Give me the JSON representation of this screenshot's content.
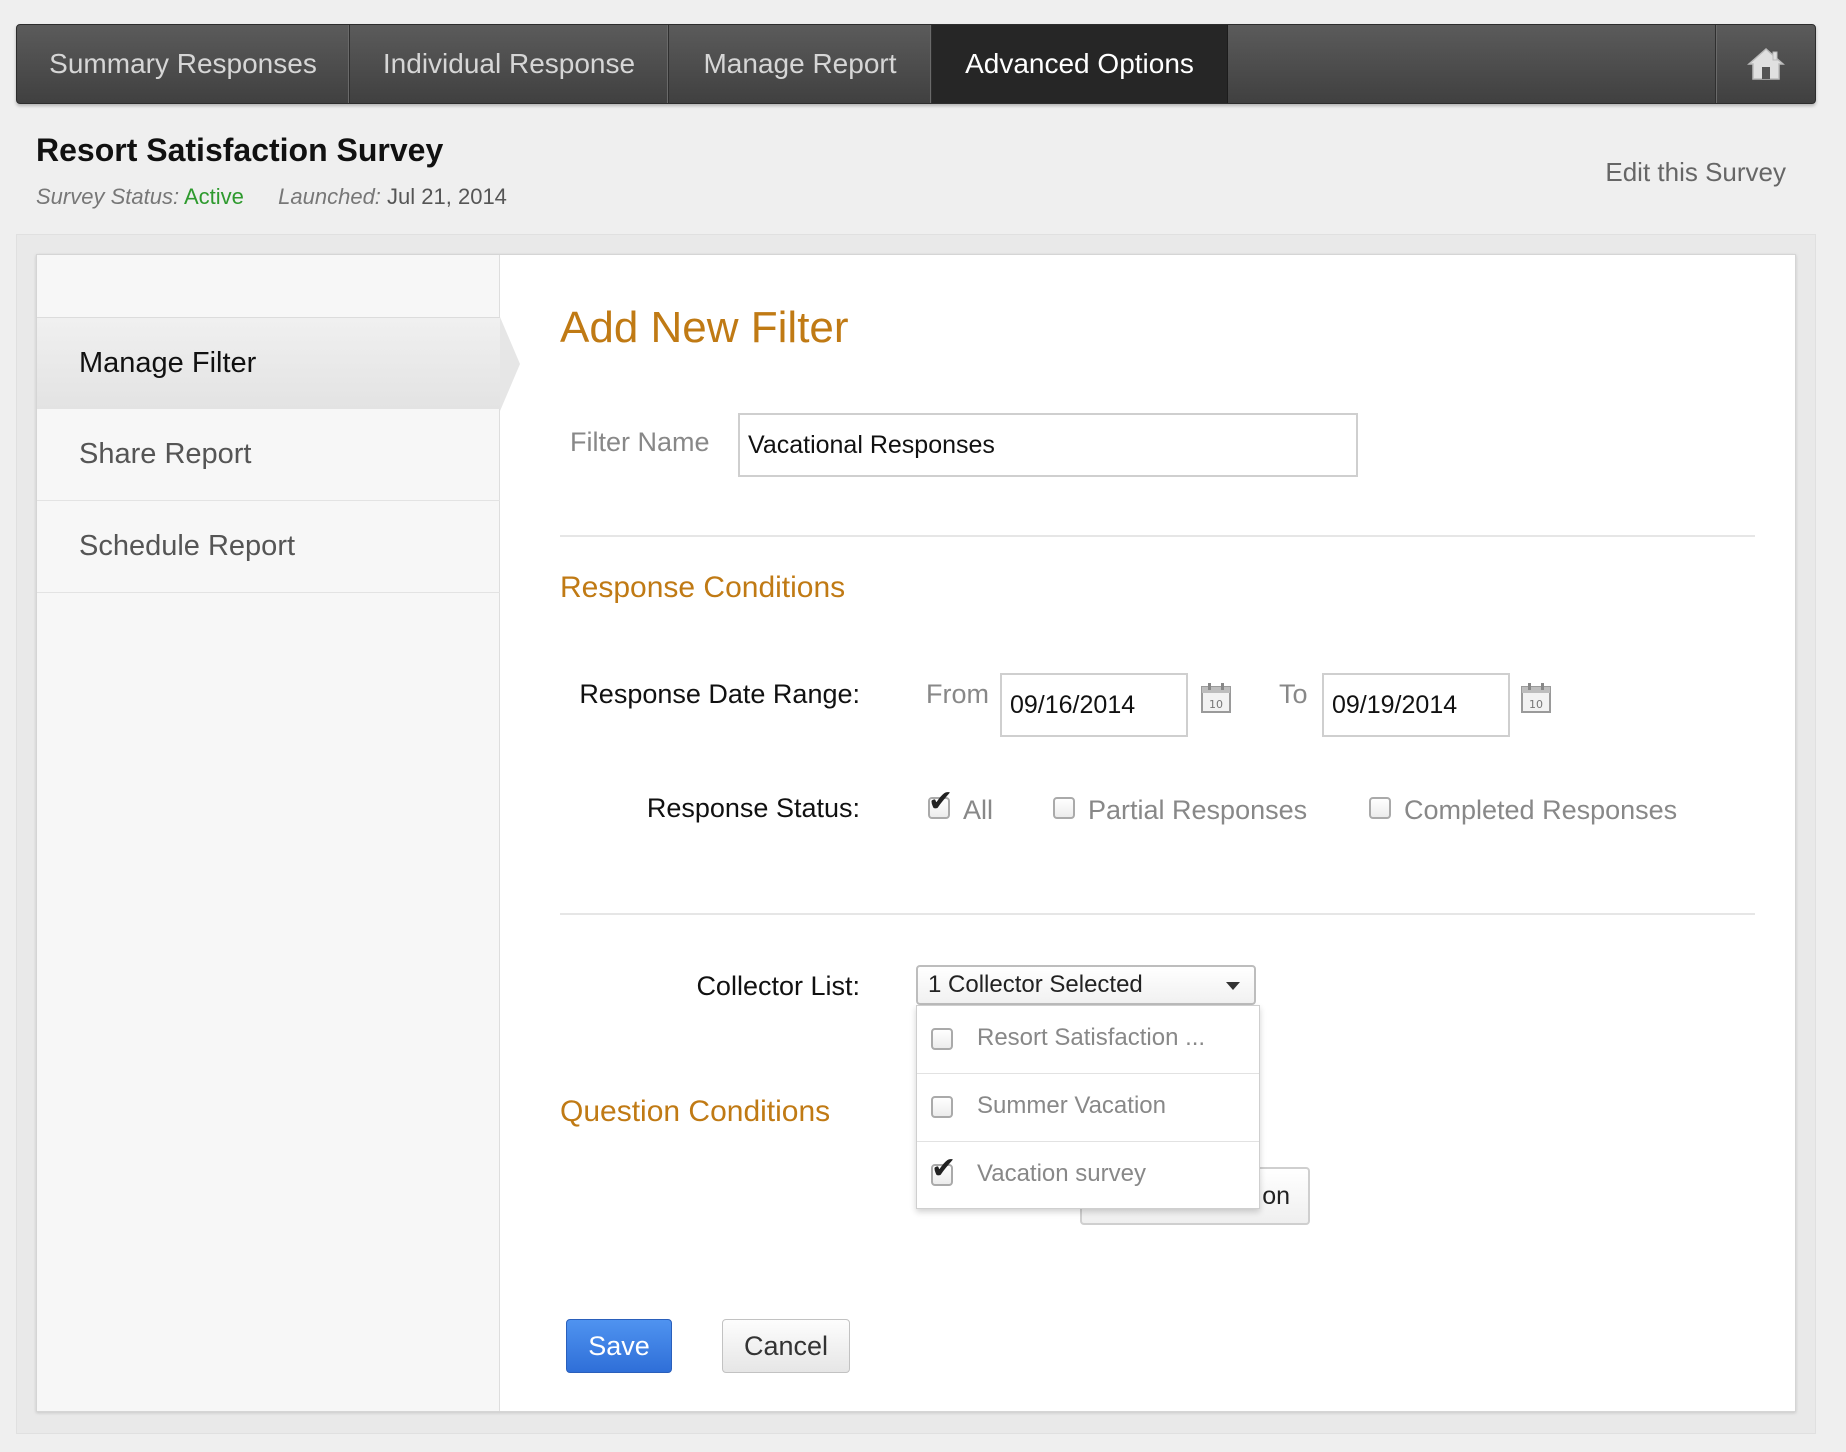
{
  "nav": {
    "tabs": [
      {
        "label": "Summary Responses"
      },
      {
        "label": "Individual Response"
      },
      {
        "label": "Manage Report"
      },
      {
        "label": "Advanced Options",
        "active": true
      }
    ],
    "home_icon": "home-icon"
  },
  "header": {
    "title": "Resort Satisfaction Survey",
    "status_label": "Survey Status:",
    "status_value": "Active",
    "launched_label": "Launched:",
    "launched_value": "Jul 21, 2014",
    "edit_link": "Edit this Survey"
  },
  "sidebar": {
    "items": [
      {
        "label": "Manage Filter",
        "active": true
      },
      {
        "label": "Share Report"
      },
      {
        "label": "Schedule Report"
      }
    ]
  },
  "form": {
    "title": "Add New Filter",
    "filter_name_label": "Filter Name",
    "filter_name_value": "Vacational Responses",
    "response_conditions_title": "Response Conditions",
    "date_range_label": "Response Date Range:",
    "from_label": "From",
    "from_value": "09/16/2014",
    "to_label": "To",
    "to_value": "09/19/2014",
    "calendar_icon_text": "10",
    "status_label": "Response Status:",
    "status_options": [
      {
        "label": "All",
        "checked": true
      },
      {
        "label": "Partial Responses",
        "checked": false
      },
      {
        "label": "Completed Responses",
        "checked": false
      }
    ],
    "collector_label": "Collector List:",
    "collector_selected": "1 Collector Selected",
    "collector_options": [
      {
        "label": "Resort Satisfaction ...",
        "checked": false
      },
      {
        "label": "Summer Vacation",
        "checked": false
      },
      {
        "label": "Vacation survey",
        "checked": true
      }
    ],
    "question_conditions_title": "Question Conditions",
    "hidden_button_partial": "on",
    "save_label": "Save",
    "cancel_label": "Cancel"
  },
  "colors": {
    "accent_heading": "#c07a14",
    "status_active": "#2e9a2e",
    "save_button": "#3b7fe4"
  }
}
